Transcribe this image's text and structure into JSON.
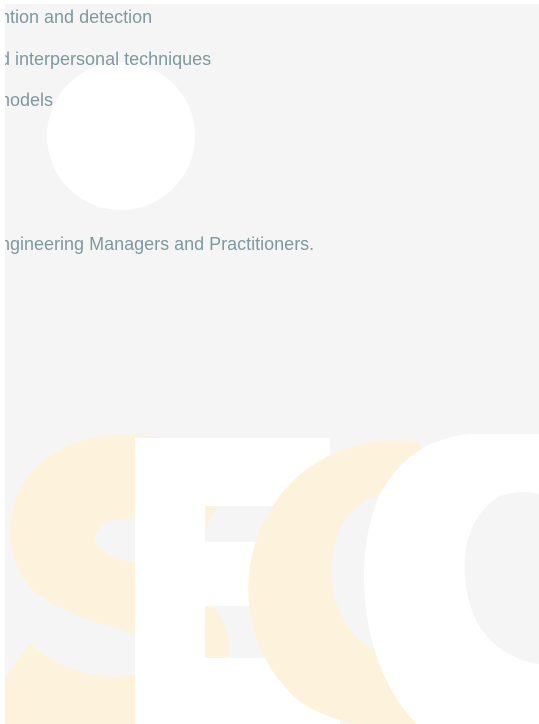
{
  "content": {
    "lines": [
      "ntion and detection",
      "d interpersonal techniques",
      "nodels",
      "ngineering Managers and Practitioners."
    ]
  },
  "watermark": {
    "letters": [
      "S",
      "E",
      "C"
    ],
    "colors": {
      "s": "#fdf2dc",
      "e": "#ffffff",
      "c_back": "#fdf2dc",
      "c_front": "#ffffff"
    }
  },
  "colors": {
    "background": "#f4f5f4",
    "text": "#7f98a0"
  }
}
